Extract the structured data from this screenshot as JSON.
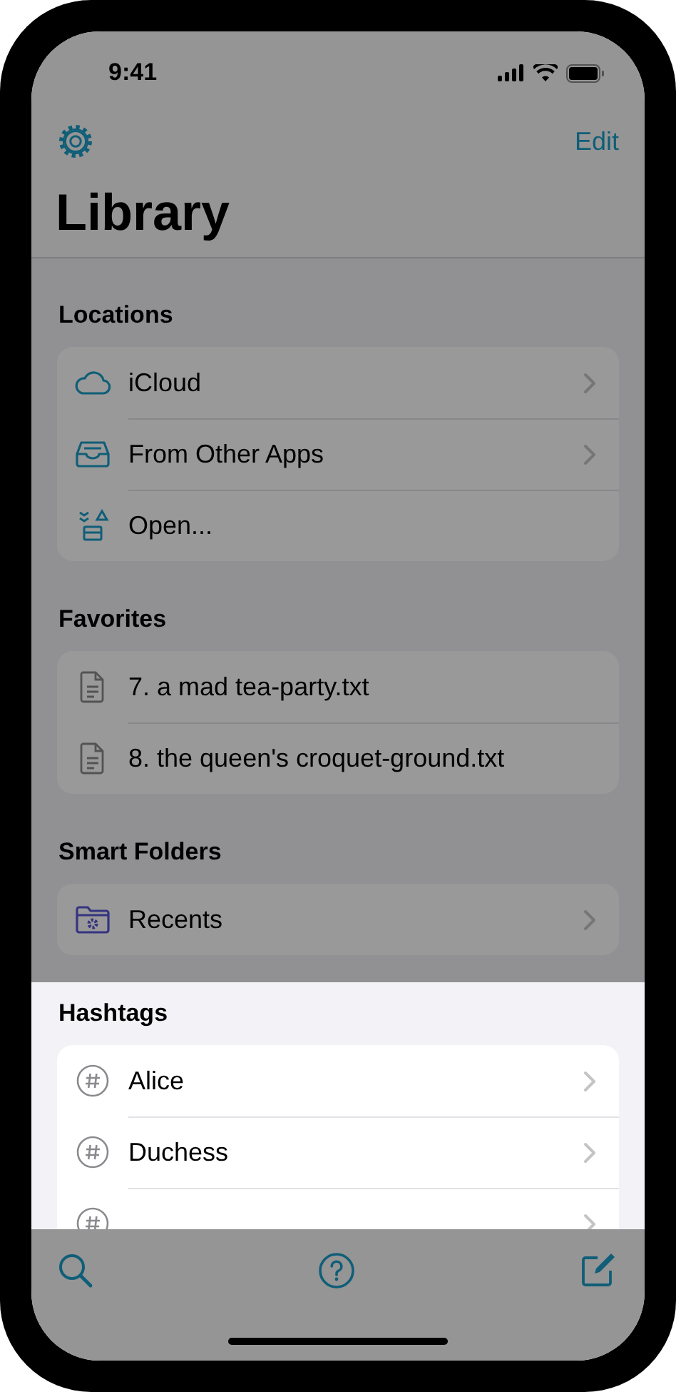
{
  "status_bar": {
    "time": "9:41"
  },
  "nav": {
    "edit_label": "Edit",
    "title": "Library",
    "dimmed": true
  },
  "sections": [
    {
      "header": "Locations",
      "dimmed": true,
      "rows": [
        {
          "label": "iCloud",
          "kind": "cloud",
          "chevron": true
        },
        {
          "label": "From Other Apps",
          "kind": "tray",
          "chevron": true
        },
        {
          "label": "Open...",
          "kind": "open",
          "chevron": false
        }
      ]
    },
    {
      "header": "Favorites",
      "dimmed": true,
      "rows": [
        {
          "label": "7. a mad tea-party.txt",
          "kind": "document",
          "chevron": false
        },
        {
          "label": "8. the queen's croquet-ground.txt",
          "kind": "document",
          "chevron": false
        }
      ]
    },
    {
      "header": "Smart Folders",
      "dimmed": true,
      "rows": [
        {
          "label": "Recents",
          "kind": "smart-folder",
          "chevron": true
        }
      ]
    },
    {
      "header": "Hashtags",
      "dimmed": false,
      "rows": [
        {
          "label": "Alice",
          "kind": "hashtag",
          "chevron": true
        },
        {
          "label": "Duchess",
          "kind": "hashtag",
          "chevron": true
        },
        {
          "kind": "hashtag",
          "chevron": true
        }
      ]
    }
  ],
  "toolbar": {
    "dimmed": true
  }
}
